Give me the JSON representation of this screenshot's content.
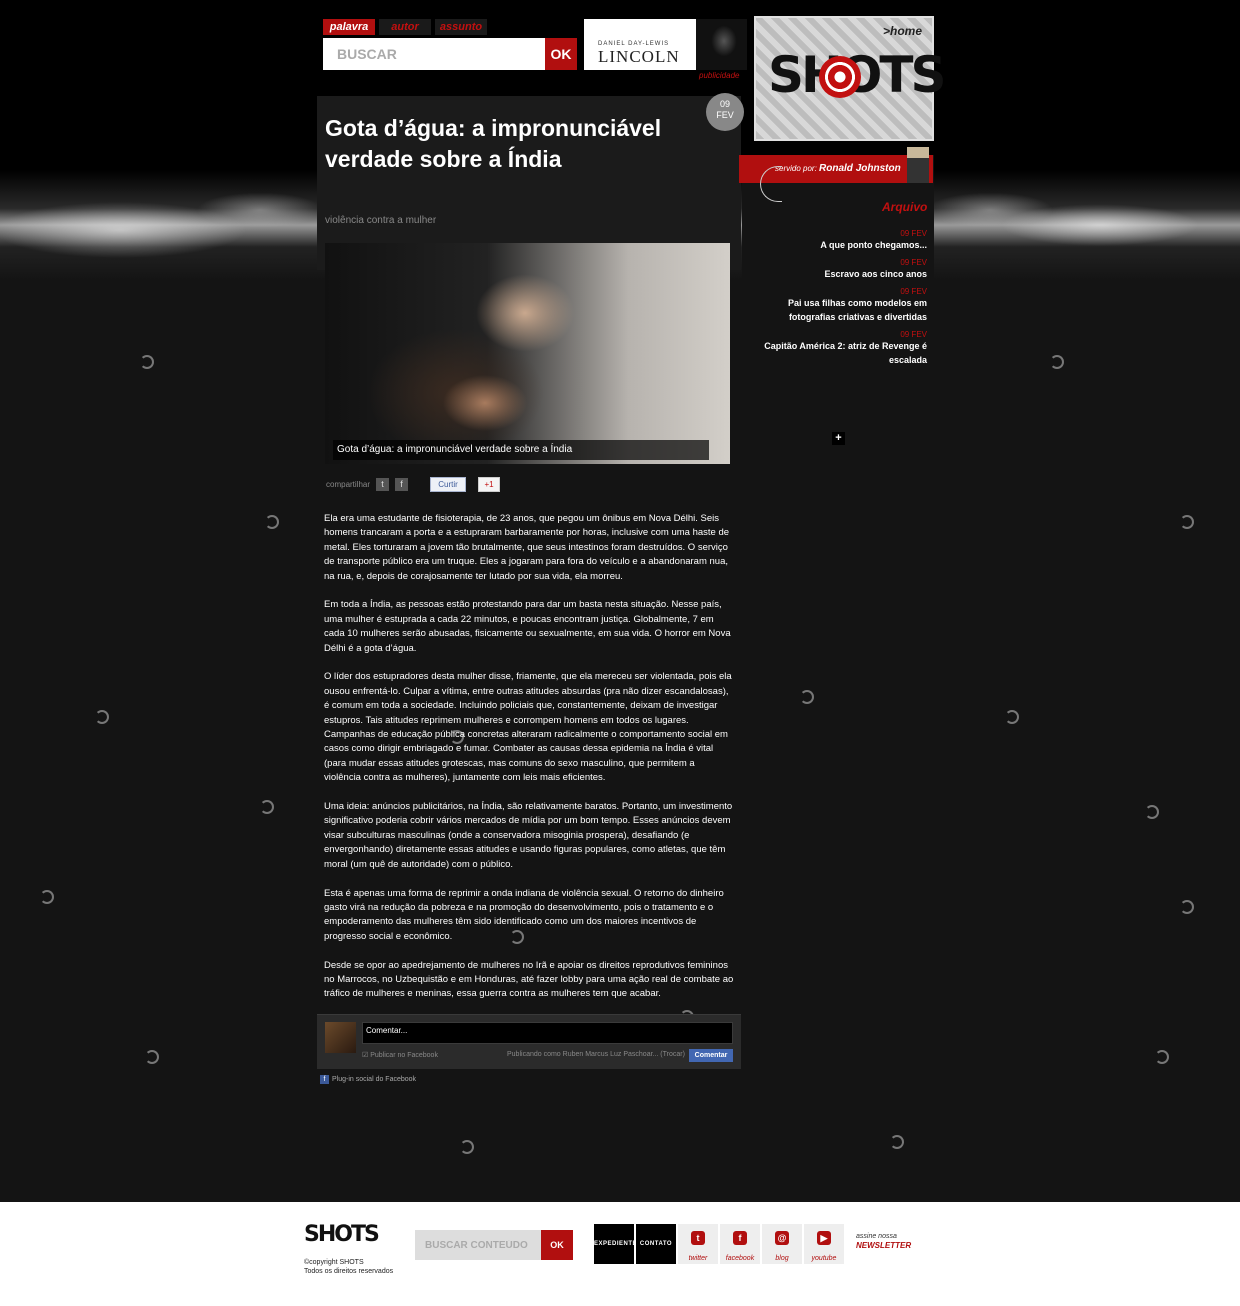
{
  "search": {
    "tabs": [
      "palavra",
      "autor",
      "assunto"
    ],
    "placeholder": "BUSCAR",
    "ok_label": "OK"
  },
  "ad": {
    "small_text": "DANIEL DAY-LEWIS",
    "title": "LINCOLN",
    "label": "publicidade"
  },
  "logo": {
    "home_label": ">home",
    "text": "SHOTS"
  },
  "article": {
    "date_day": "09",
    "date_month": "FEV",
    "title": "Gota d’água: a impronunciável verdade sobre a Índia",
    "subtitle": "violência contra a mulher",
    "image_caption": "Gota d’água: a impronunciável verdade sobre a Índia",
    "share_label": "compartilhar",
    "like_label": "Curtir",
    "gplus_label": "+1",
    "paragraphs": [
      "Ela era uma estudante de fisioterapia, de 23 anos, que pegou um ônibus em Nova Délhi. Seis homens trancaram a porta e a estupraram barbaramente por horas, inclusive com uma haste de metal. Eles torturaram a jovem tão brutalmente, que seus intestinos foram destruídos. O serviço de transporte público era um truque. Eles a jogaram para fora do veículo e a abandonaram nua, na rua, e, depois de corajosamente ter lutado por sua vida, ela morreu.",
      "Em toda a Índia, as pessoas estão protestando para dar um basta nesta situação. Nesse país, uma mulher é estuprada a cada 22 minutos, e poucas encontram justiça. Globalmente, 7 em cada 10 mulheres serão abusadas, fisicamente ou sexualmente, em sua vida. O horror em Nova Délhi é a gota d’água.",
      "O líder dos estupradores desta mulher disse, friamente, que ela mereceu ser violentada, pois ela ousou enfrentá-lo. Culpar a vítima, entre outras atitudes absurdas (pra não dizer escandalosas), é comum em toda a sociedade. Incluindo policiais que, constantemente, deixam de investigar estupros. Tais atitudes reprimem mulheres e corrompem homens em todos os lugares. Campanhas de educação pública concretas alteraram radicalmente o comportamento social em casos como dirigir embriagado e fumar. Combater as causas dessa epidemia na Índia é vital (para mudar essas atitudes grotescas, mas comuns do sexo masculino, que permitem a violência contra as mulheres), juntamente com leis mais eficientes.",
      "Uma ideia: anúncios publicitários, na Índia, são relativamente baratos. Portanto, um investimento significativo poderia cobrir vários mercados de mídia por um bom tempo. Esses anúncios devem visar subculturas masculinas (onde a conservadora misoginia prospera), desafiando (e envergonhando) diretamente essas atitudes e usando figuras populares, como atletas, que têm moral (um quê de autoridade) com o público.",
      "Esta é apenas uma forma de reprimir a onda indiana de violência sexual. O retorno do dinheiro gasto virá na redução da pobreza e na promoção do desenvolvimento, pois o tratamento e o empoderamento das mulheres têm sido identificado como um dos maiores incentivos de progresso social e econômico.",
      "Desde se opor ao apedrejamento de mulheres no Irã e apoiar os direitos reprodutivos femininos no Marrocos, no Uzbequistão e em Honduras, até fazer lobby para uma ação real de combate ao tráfico de mulheres e meninas, essa guerra contra as mulheres tem que acabar."
    ]
  },
  "comments": {
    "placeholder": "Comentar...",
    "publish_label": "Publicar no Facebook",
    "publishing_as": "Publicando como Ruben Marcus Luz Paschoar... (Trocar)",
    "submit_label": "Comentar",
    "plugin_label": "Plug-in social do Facebook"
  },
  "sidebar": {
    "served_by_prefix": "servido por:",
    "author": "Ronald Johnston",
    "archive_title": "Arquivo",
    "items": [
      {
        "date": "09 FEV",
        "title": "A que ponto chegamos..."
      },
      {
        "date": "09 FEV",
        "title": "Escravo aos cinco anos"
      },
      {
        "date": "09 FEV",
        "title": "Pai usa filhas como modelos em fotografias criativas e divertidas"
      },
      {
        "date": "09 FEV",
        "title": "Capitão América 2: atriz de Revenge é escalada"
      }
    ],
    "more_label": "+"
  },
  "footer": {
    "logo_text": "SHOTS",
    "copyright_line1": "©copyright SHOTS",
    "copyright_line2": "Todos os direitos reservados",
    "search_placeholder": "BUSCAR CONTEÚDO",
    "ok_label": "OK",
    "nav": [
      "EXPEDIENTE",
      "CONTATO"
    ],
    "social": [
      {
        "icon": "twitter-icon",
        "glyph": "t",
        "label": "twitter"
      },
      {
        "icon": "facebook-icon",
        "glyph": "f",
        "label": "facebook"
      },
      {
        "icon": "blog-icon",
        "glyph": "@",
        "label": "blog"
      },
      {
        "icon": "youtube-icon",
        "glyph": "▶",
        "label": "youtube"
      }
    ],
    "newsletter_prefix": "assine nossa",
    "newsletter_label": "NEWSLETTER"
  },
  "colors": {
    "accent": "#b10f0f",
    "background": "#141414"
  }
}
